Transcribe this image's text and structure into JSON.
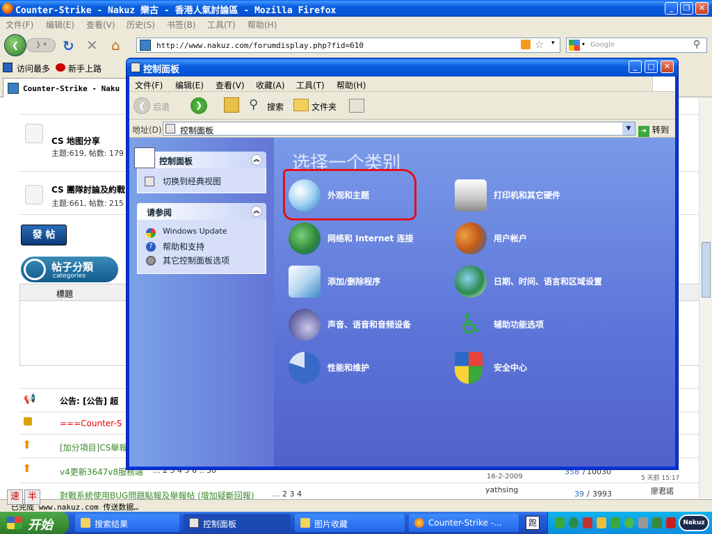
{
  "firefox": {
    "title": "Counter-Strike - Nakuz 樂古 - 香港人氣討論區 - Mozilla Firefox",
    "menu": [
      "文件(F)",
      "编辑(E)",
      "查看(V)",
      "历史(S)",
      "书签(B)",
      "工具(T)",
      "帮助(H)"
    ],
    "url": "http://www.nakuz.com/forumdisplay.php?fid=610",
    "search_placeholder": "Google",
    "bookmarks": [
      "访问最多",
      "新手上路"
    ],
    "tab_title": "Counter-Strike - Naku"
  },
  "forum": {
    "items": [
      {
        "title": "CS 地图分享",
        "sub": "主题:619, 帖数: 179"
      },
      {
        "title": "CS 團隊討論及約戰",
        "sub": "主题:661, 帖数: 215"
      }
    ],
    "post_button": "發 帖",
    "categories_title": "帖子分類",
    "categories_sub": "categories",
    "column_title": "標題",
    "announcement": "公告: [公告] 超",
    "rows": [
      "===Counter-S",
      "[加分項目]CS舉報",
      "v4更新3647v8服務端",
      "對戰系統使用BUG問題點報及舉報帖 (增加疑斷回報)"
    ],
    "pages_row3": "... 2 3 4 5 6 .. 30",
    "pages_row4": "... 2 3 4",
    "row3_date": "16-2-2009",
    "row3_replies": "358",
    "row3_views": "10030",
    "row3_last": "5 天前 15:17",
    "row4_author": "yathsing",
    "row4_replies": "39",
    "row4_views": "3993",
    "row4_last": "廖君諾"
  },
  "statusbar": "已完成 www.nakuz.com 传送数据…",
  "ime": [
    "速",
    "半"
  ],
  "control_panel": {
    "title": "控制面板",
    "menu": [
      "文件(F)",
      "编辑(E)",
      "查看(V)",
      "收藏(A)",
      "工具(T)",
      "帮助(H)"
    ],
    "toolbar": {
      "back": "后退",
      "search": "搜索",
      "folders": "文件夹"
    },
    "address_label": "地址(D)",
    "address_value": "控制面板",
    "go_label": "转到",
    "left_panel": {
      "title": "控制面板",
      "switch_link": "切换到经典视图",
      "see_also_title": "请参阅",
      "see_also": [
        "Windows Update",
        "帮助和支持",
        "其它控制面板选项"
      ]
    },
    "heading": "选择一个类别",
    "categories": [
      {
        "label": "外观和主题",
        "icon": "appearance-icon"
      },
      {
        "label": "打印机和其它硬件",
        "icon": "printer-icon"
      },
      {
        "label": "网络和 Internet 连接",
        "icon": "network-icon"
      },
      {
        "label": "用户帐户",
        "icon": "users-icon"
      },
      {
        "label": "添加/删除程序",
        "icon": "add-remove-icon"
      },
      {
        "label": "日期、时间、语言和区域设置",
        "icon": "date-time-icon"
      },
      {
        "label": "声音、语音和音频设备",
        "icon": "sound-icon"
      },
      {
        "label": "辅助功能选项",
        "icon": "accessibility-icon"
      },
      {
        "label": "性能和维护",
        "icon": "performance-icon"
      },
      {
        "label": "安全中心",
        "icon": "security-shield-icon"
      }
    ]
  },
  "taskbar": {
    "start": "开始",
    "buttons": [
      "搜索结果",
      "控制面板",
      "图片收藏",
      "Counter-Strike -..."
    ]
  }
}
